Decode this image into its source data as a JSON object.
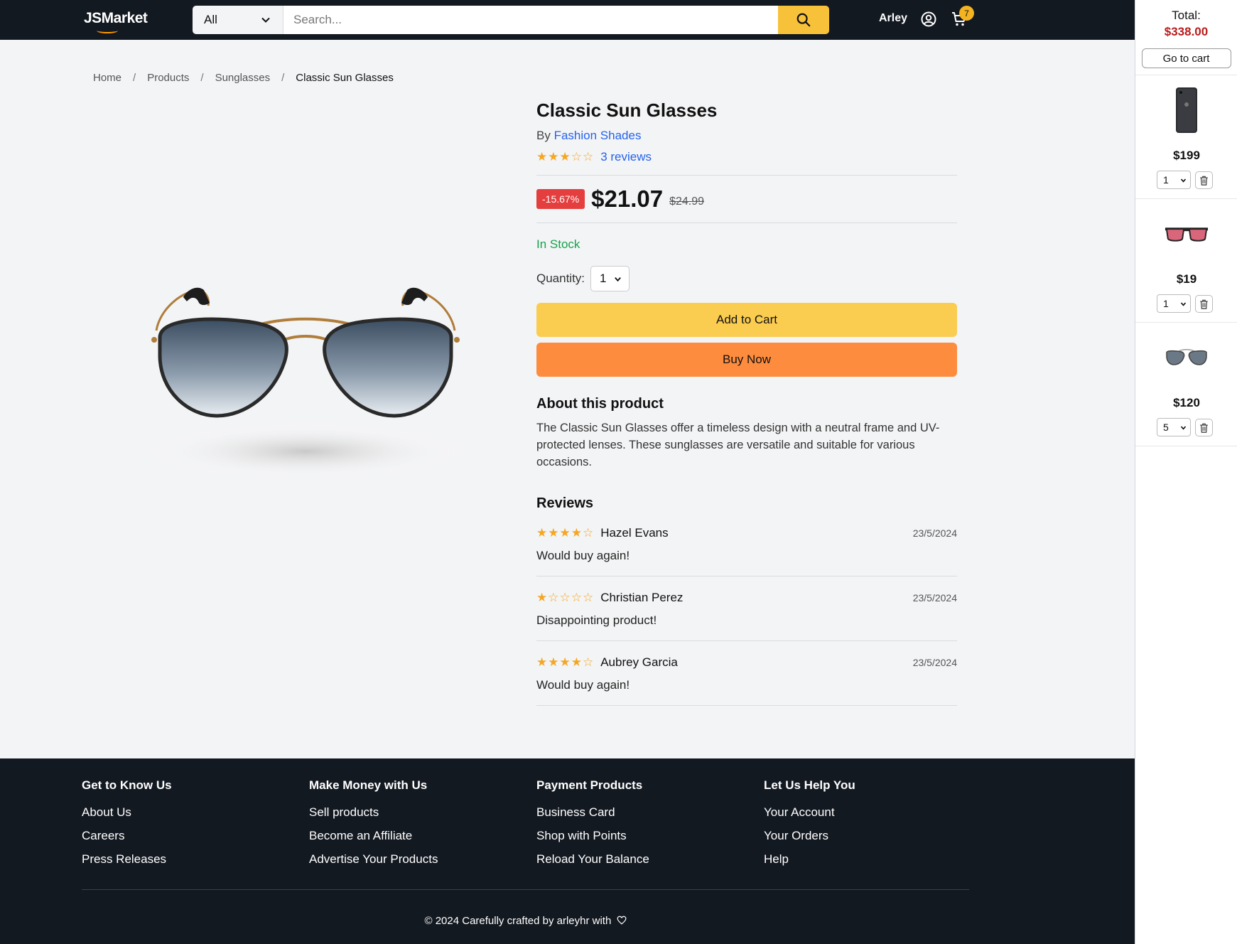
{
  "header": {
    "logo": "JSMarket",
    "category": "All",
    "search_placeholder": "Search...",
    "user_name": "Arley",
    "cart_count": "7"
  },
  "breadcrumb": [
    "Home",
    "Products",
    "Sunglasses",
    "Classic Sun Glasses"
  ],
  "product": {
    "title": "Classic Sun Glasses",
    "by_label": "By",
    "brand": "Fashion Shades",
    "rating_stars": "★★★☆☆",
    "rating": 3,
    "reviews_link": "3 reviews",
    "discount": "-15.67%",
    "price": "$21.07",
    "old_price": "$24.99",
    "stock": "In Stock",
    "quantity_label": "Quantity:",
    "quantity": "1",
    "add_to_cart": "Add to Cart",
    "buy_now": "Buy Now",
    "about_title": "About this product",
    "about_text": "The Classic Sun Glasses offer a timeless design with a neutral frame and UV-protected lenses. These sunglasses are versatile and suitable for various occasions.",
    "reviews_title": "Reviews"
  },
  "reviews": [
    {
      "stars": "★★★★☆",
      "rating": 4,
      "name": "Hazel Evans",
      "date": "23/5/2024",
      "text": "Would buy again!"
    },
    {
      "stars": "★☆☆☆☆",
      "rating": 1,
      "name": "Christian Perez",
      "date": "23/5/2024",
      "text": "Disappointing product!"
    },
    {
      "stars": "★★★★☆",
      "rating": 4,
      "name": "Aubrey Garcia",
      "date": "23/5/2024",
      "text": "Would buy again!"
    }
  ],
  "footer": {
    "columns": [
      {
        "title": "Get to Know Us",
        "links": [
          "About Us",
          "Careers",
          "Press Releases"
        ]
      },
      {
        "title": "Make Money with Us",
        "links": [
          "Sell products",
          "Become an Affiliate",
          "Advertise Your Products"
        ]
      },
      {
        "title": "Payment Products",
        "links": [
          "Business Card",
          "Shop with Points",
          "Reload Your Balance"
        ]
      },
      {
        "title": "Let Us Help You",
        "links": [
          "Your Account",
          "Your Orders",
          "Help"
        ]
      }
    ],
    "copyright": "© 2024 Carefully crafted by arleyhr with"
  },
  "side_cart": {
    "total_label": "Total:",
    "total": "$338.00",
    "go_to_cart": "Go to cart",
    "items": [
      {
        "image": "phone-icon",
        "price": "$199",
        "qty": "1"
      },
      {
        "image": "red-sunglasses-icon",
        "price": "$19",
        "qty": "1"
      },
      {
        "image": "aviator-sunglasses-icon",
        "price": "$120",
        "qty": "5"
      }
    ]
  },
  "colors": {
    "header_bg": "#131921",
    "search_button": "#f8c13a",
    "add_to_cart": "#facc4f",
    "buy_now": "#fe8c3e",
    "discount": "#e53e3e",
    "in_stock": "#16a34a",
    "link": "#2563eb",
    "total": "#b91c1c"
  }
}
